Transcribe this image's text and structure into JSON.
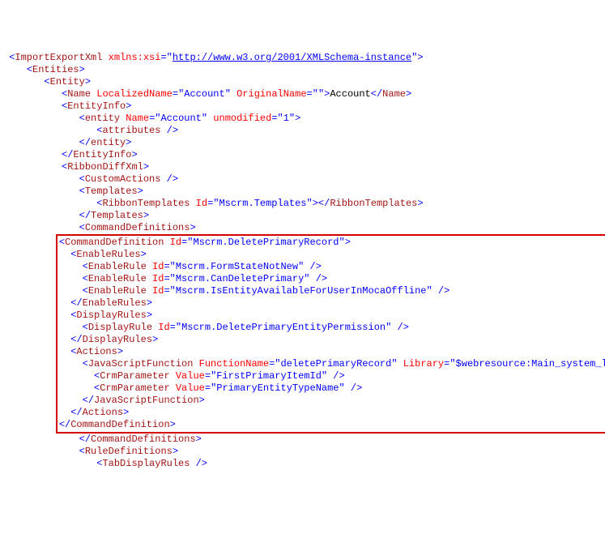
{
  "gutter_chars": " ",
  "lines": {
    "l01": {
      "indent": 0,
      "pre": "<",
      "el": "ImportExportXml",
      "attrs": [
        {
          "n": "xmlns:xsi",
          "v": "http://www.w3.org/2001/XMLSchema-instance",
          "link": true
        }
      ],
      "tail": ">"
    },
    "l02": {
      "indent": 1,
      "pre": "<",
      "el": "Entities",
      "tail": ">"
    },
    "l03": {
      "indent": 2,
      "pre": "<",
      "el": "Entity",
      "tail": ">"
    },
    "l04": {
      "indent": 3,
      "pre": "<",
      "el": "Name",
      "attrs": [
        {
          "n": "LocalizedName",
          "v": "Account"
        },
        {
          "n": "OriginalName",
          "v": ""
        }
      ],
      "tail": ">",
      "text": "Account",
      "close": "Name"
    },
    "l05": {
      "indent": 3,
      "pre": "<",
      "el": "EntityInfo",
      "tail": ">"
    },
    "l06": {
      "indent": 4,
      "pre": "<",
      "el": "entity",
      "attrs": [
        {
          "n": "Name",
          "v": "Account"
        },
        {
          "n": "unmodified",
          "v": "1"
        }
      ],
      "tail": ">"
    },
    "l07": {
      "indent": 5,
      "pre": "<",
      "el": "attributes",
      "tail": " />"
    },
    "l08": {
      "indent": 4,
      "pre": "</",
      "el": "entity",
      "tail": ">"
    },
    "l09": {
      "indent": 3,
      "pre": "</",
      "el": "EntityInfo",
      "tail": ">"
    },
    "l10": {
      "indent": 3,
      "pre": "<",
      "el": "RibbonDiffXml",
      "tail": ">"
    },
    "l11": {
      "indent": 4,
      "pre": "<",
      "el": "CustomActions",
      "tail": " />"
    },
    "l12": {
      "indent": 4,
      "pre": "<",
      "el": "Templates",
      "tail": ">"
    },
    "l13": {
      "indent": 5,
      "pre": "<",
      "el": "RibbonTemplates",
      "attrs": [
        {
          "n": "Id",
          "v": "Mscrm.Templates"
        }
      ],
      "tail": ">",
      "close": "RibbonTemplates"
    },
    "l14": {
      "indent": 4,
      "pre": "</",
      "el": "Templates",
      "tail": ">"
    },
    "l15": {
      "indent": 4,
      "pre": "<",
      "el": "CommandDefinitions",
      "tail": ">"
    },
    "l16": {
      "indent": 5,
      "pre": "<",
      "el": "CommandDefinition",
      "attrs": [
        {
          "n": "Id",
          "v": "Mscrm.DeletePrimaryRecord"
        }
      ],
      "tail": ">"
    },
    "l17": {
      "indent": 6,
      "pre": "<",
      "el": "EnableRules",
      "tail": ">"
    },
    "l18": {
      "indent": 7,
      "pre": "<",
      "el": "EnableRule",
      "attrs": [
        {
          "n": "Id",
          "v": "Mscrm.FormStateNotNew"
        }
      ],
      "tail": " />"
    },
    "l19": {
      "indent": 7,
      "pre": "<",
      "el": "EnableRule",
      "attrs": [
        {
          "n": "Id",
          "v": "Mscrm.CanDeletePrimary"
        }
      ],
      "tail": " />"
    },
    "l20": {
      "indent": 7,
      "pre": "<",
      "el": "EnableRule",
      "attrs": [
        {
          "n": "Id",
          "v": "Mscrm.IsEntityAvailableForUserInMocaOffline"
        }
      ],
      "tail": " />"
    },
    "l21": {
      "indent": 6,
      "pre": "</",
      "el": "EnableRules",
      "tail": ">"
    },
    "l22": {
      "indent": 6,
      "pre": "<",
      "el": "DisplayRules",
      "tail": ">"
    },
    "l23": {
      "indent": 7,
      "pre": "<",
      "el": "DisplayRule",
      "attrs": [
        {
          "n": "Id",
          "v": "Mscrm.DeletePrimaryEntityPermission"
        }
      ],
      "tail": " />"
    },
    "l24": {
      "indent": 6,
      "pre": "</",
      "el": "DisplayRules",
      "tail": ">"
    },
    "l25": {
      "indent": 6,
      "pre": "<",
      "el": "Actions",
      "tail": ">"
    },
    "l26": {
      "indent": 7,
      "pre": "<",
      "el": "JavaScriptFunction",
      "attrs": [
        {
          "n": "FunctionName",
          "v": "deletePrimaryRecord"
        },
        {
          "n": "Library",
          "v": "$webresource:Main_system_library.js"
        }
      ],
      "tail": ">"
    },
    "l27": {
      "indent": 8,
      "pre": "<",
      "el": "CrmParameter",
      "attrs": [
        {
          "n": "Value",
          "v": "FirstPrimaryItemId"
        }
      ],
      "tail": " />"
    },
    "l28": {
      "indent": 8,
      "pre": "<",
      "el": "CrmParameter",
      "attrs": [
        {
          "n": "Value",
          "v": "PrimaryEntityTypeName"
        }
      ],
      "tail": " />"
    },
    "l29": {
      "indent": 7,
      "pre": "</",
      "el": "JavaScriptFunction",
      "tail": ">"
    },
    "l30": {
      "indent": 6,
      "pre": "</",
      "el": "Actions",
      "tail": ">"
    },
    "l31": {
      "indent": 5,
      "pre": "</",
      "el": "CommandDefinition",
      "tail": ">"
    },
    "l32": {
      "indent": 4,
      "pre": "</",
      "el": "CommandDefinitions",
      "tail": ">"
    },
    "l33": {
      "indent": 4,
      "pre": "<",
      "el": "RuleDefinitions",
      "tail": ">"
    },
    "l34": {
      "indent": 5,
      "pre": "<",
      "el": "TabDisplayRules",
      "tail": " />"
    }
  },
  "highlight": {
    "start": "l16",
    "end": "l31"
  }
}
